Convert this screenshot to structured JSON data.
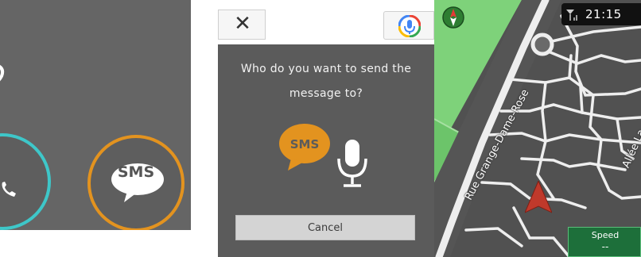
{
  "left_panel": {
    "sms_label": "SMS",
    "icons": [
      "phone-icon",
      "sms-bubble-icon"
    ],
    "colors": {
      "call_ring": "#3ec7c9",
      "sms_ring": "#e3931f"
    }
  },
  "dialog": {
    "close_symbol": "✕",
    "prompt_line1": "Who do you want to send the",
    "prompt_line2": "message to?",
    "sms_label": "SMS",
    "cancel_label": "Cancel",
    "icons": [
      "close-icon",
      "voice-assistant-icon",
      "sms-bubble-icon",
      "microphone-icon"
    ],
    "colors": {
      "sms_bubble": "#e3931f"
    }
  },
  "map": {
    "time": "21:15",
    "streets": [
      "Rue Grange-Dame-Rose",
      "Allée La"
    ],
    "speed_label": "Speed",
    "speed_value": "--",
    "icons": [
      "compass-icon",
      "signal-icon",
      "position-arrow-icon"
    ],
    "colors": {
      "park": "#7ed27a",
      "position_arrow": "#c0392b",
      "speed_box": "#1d6f3a"
    }
  }
}
